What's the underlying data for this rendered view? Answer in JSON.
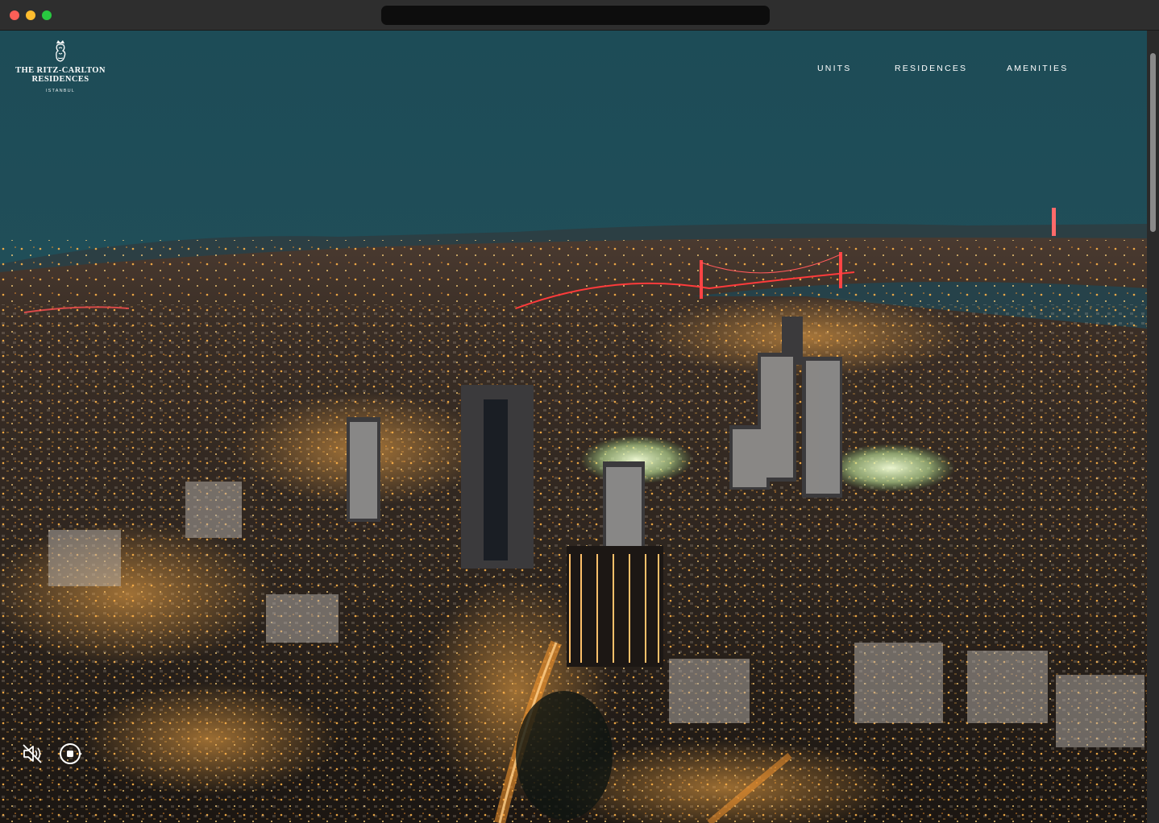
{
  "logo": {
    "line1": "THE RITZ-CARLTON",
    "line2": "RESIDENCES",
    "sub": "ISTANBUL",
    "icon": "lion-crown-icon"
  },
  "nav": {
    "items": [
      {
        "label": "UNITS"
      },
      {
        "label": "RESIDENCES"
      },
      {
        "label": "AMENITIES"
      }
    ]
  },
  "controls": {
    "mute_icon": "speaker-muted-icon",
    "stop_icon": "stop-circle-icon"
  },
  "colors": {
    "sky_top": "#1d4c57",
    "sky_horizon": "#2a4f58",
    "city_dark": "#1a1410",
    "city_light": "#ff9a2e",
    "bridge": "#ff3b3b"
  }
}
